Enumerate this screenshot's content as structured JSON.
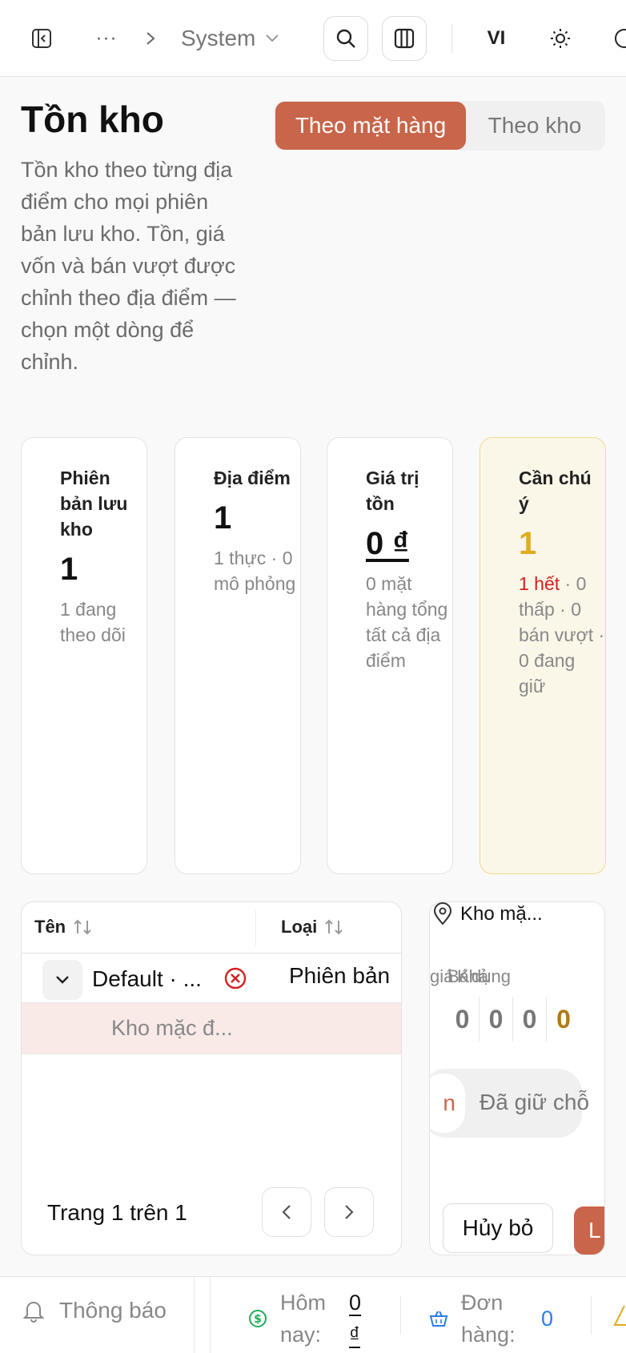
{
  "topbar": {
    "breadcrumb_more": "···",
    "breadcrumb_current": "System",
    "language": "VI"
  },
  "header": {
    "title": "Tồn kho",
    "description": "Tồn kho theo từng địa điểm cho mọi phiên bản lưu kho. Tồn, giá vốn và bán vượt được chỉnh theo địa điểm — chọn một dòng để chỉnh.",
    "view_toggle": {
      "by_item": "Theo mặt hàng",
      "by_warehouse": "Theo kho",
      "selected": "by_item"
    }
  },
  "stats": {
    "variants": {
      "label": "Phiên bản lưu kho",
      "value": "1",
      "sub": "1 đang theo dõi"
    },
    "locations": {
      "label": "Địa điểm",
      "value": "1",
      "sub": "1 thực · 0 mô phỏng"
    },
    "stock_value": {
      "label": "Giá trị tồn",
      "value": "0 ₫",
      "sub": "0 mặt hàng tổng tất cả địa điểm"
    },
    "attention": {
      "label": "Cần chú ý",
      "value": "1",
      "sub_danger": "1 hết",
      "sub_rest": "· 0 thấp · 0 bán vượt · 0 đang giữ"
    }
  },
  "table": {
    "columns": [
      "Tên",
      "Loại"
    ],
    "rows": [
      {
        "name": "Default · ...",
        "type": "Phiên bản"
      }
    ],
    "subrow": "Kho mặc đ...",
    "pager": "Trang 1 trên 1"
  },
  "detail": {
    "location": "Kho mặ...",
    "col_labels": [
      "giá",
      "Bán",
      "Khả",
      "dụng"
    ],
    "values": [
      "0",
      "0",
      "0",
      "0"
    ],
    "tab_active": "n",
    "tab_inactive": "Đã giữ chỗ",
    "cancel": "Hủy bỏ",
    "save": "L"
  },
  "footer": {
    "notifications": "Thông báo",
    "today_label": "Hôm nay:",
    "today_value": "0 ₫",
    "orders_label": "Đơn hàng:",
    "orders_value": "0"
  },
  "colors": {
    "accent": "#c8654a",
    "danger": "#d42020",
    "warning": "#e0ad1a"
  }
}
